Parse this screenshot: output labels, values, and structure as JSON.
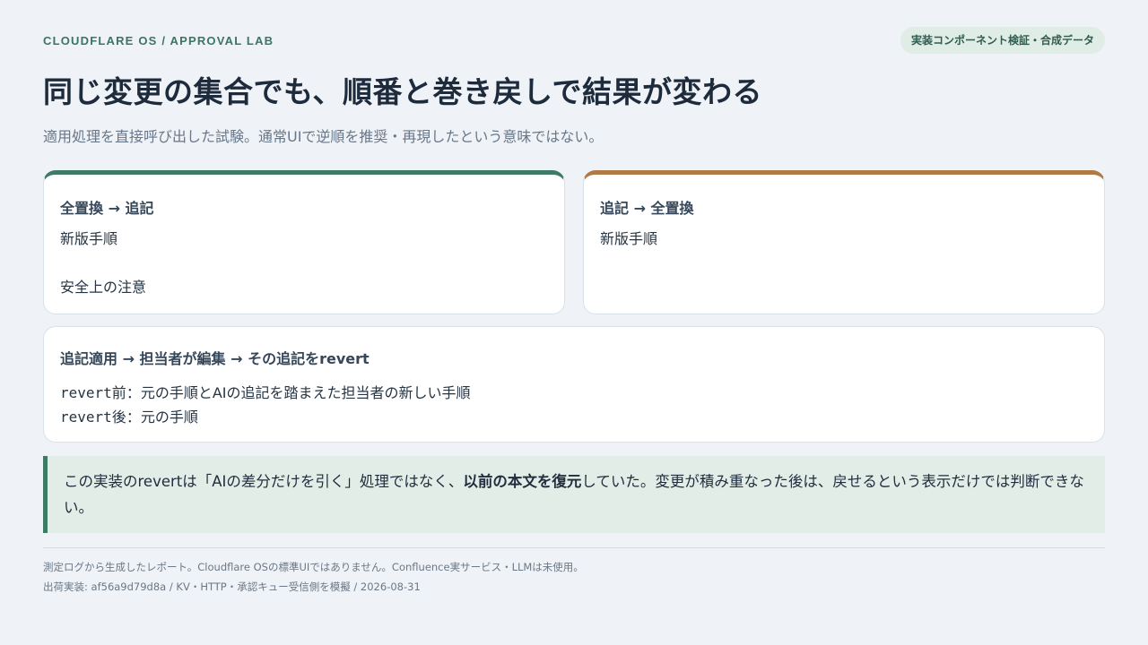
{
  "header": {
    "eyebrow": "CLOUDFLARE OS / APPROVAL LAB",
    "badge": "実装コンポーネント検証・合成データ",
    "title": "同じ変更の集合でも、順番と巻き戻しで結果が変わる",
    "subtitle": "適用処理を直接呼び出した試験。通常UIで逆順を推奨・再現したという意味ではない。"
  },
  "cards": {
    "left": {
      "heading": "全置換 → 追記",
      "lines": [
        "新版手順",
        "安全上の注意"
      ]
    },
    "right": {
      "heading": "追記 → 全置換",
      "lines": [
        "新版手順"
      ]
    },
    "wide": {
      "heading": "追記適用 → 担当者が編集 → その追記をrevert",
      "before_code": "revert前",
      "before_text": "：元の手順とAIの追記を踏まえた担当者の新しい手順",
      "after_code": "revert後",
      "after_text": "：元の手順"
    }
  },
  "callout": {
    "text_pre": "この実装のrevertは「AIの差分だけを引く」処理ではなく、",
    "text_bold": "以前の本文を復元",
    "text_post": "していた。変更が積み重なった後は、戻せるという表示だけでは判断できない。"
  },
  "footer": {
    "line1": "測定ログから生成したレポート。Cloudflare OSの標準UIではありません。Confluence実サービス・LLMは未使用。",
    "line2": "出荷実装: af56a9d79d8a / KV・HTTP・承認キュー受信側を模擬 / 2026-08-31"
  },
  "colors": {
    "background": "#eff2f6",
    "accent_green": "#3f7a67",
    "accent_brown": "#b07a47",
    "callout_bg": "#e2ede7"
  }
}
